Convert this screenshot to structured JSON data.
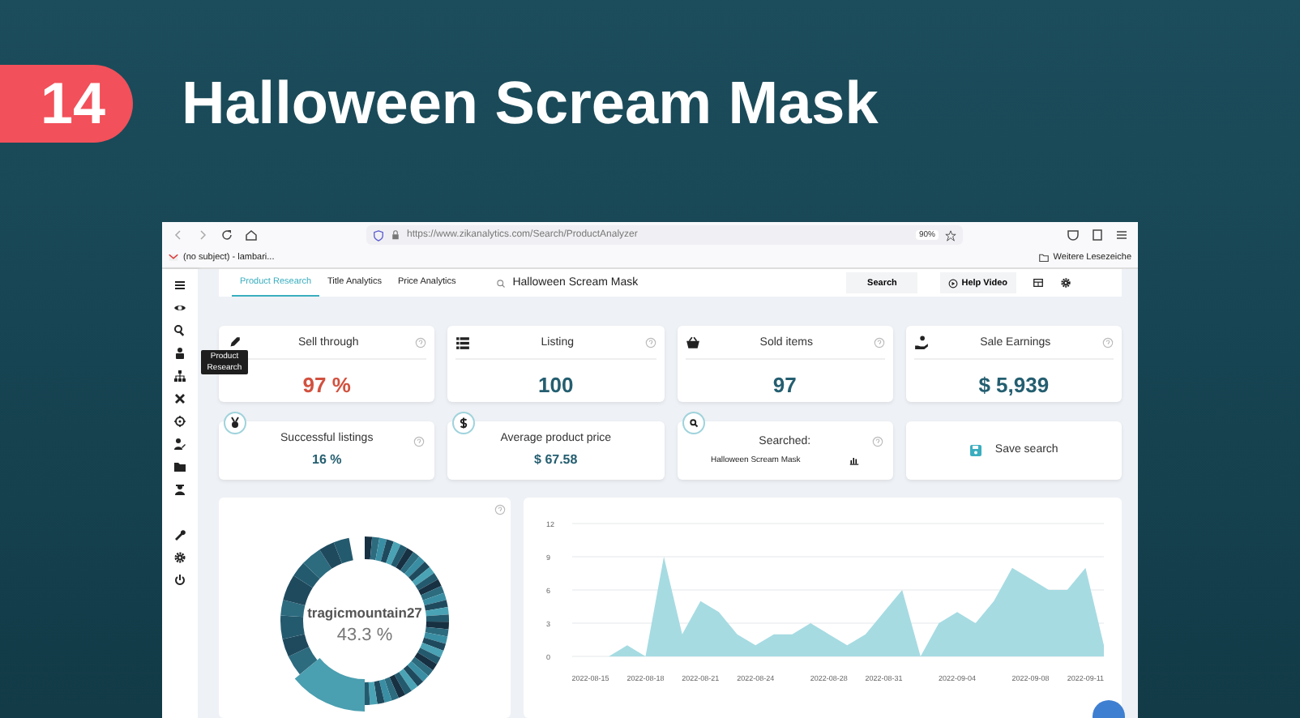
{
  "badge": "14",
  "title": "Halloween Scream Mask",
  "browser": {
    "url": "https://www.zikanalytics.com/Search/ProductAnalyzer",
    "zoom": "90%",
    "bookmarks": [
      {
        "kind": "mail",
        "label": "(no subject) - lambari..."
      },
      {
        "kind": "folder",
        "label": "Weitere Lesezeiche"
      }
    ]
  },
  "nav": {
    "tabs": [
      {
        "label": "Product Research",
        "selected": true
      },
      {
        "label": "Title Analytics",
        "selected": false
      },
      {
        "label": "Price Analytics",
        "selected": false
      }
    ],
    "search": {
      "value": "Halloween Scream Mask"
    },
    "search_button": "Search",
    "help_button": "Help Video"
  },
  "tooltip": "Product Research",
  "stats": [
    {
      "label": "Sell through",
      "value": "97 %",
      "highlight": true
    },
    {
      "label": "Listing",
      "value": "100",
      "highlight": false
    },
    {
      "label": "Sold items",
      "value": "97",
      "highlight": false
    },
    {
      "label": "Sale Earnings",
      "value": "$ 5,939",
      "highlight": false
    }
  ],
  "cards": [
    {
      "kind": "stat",
      "label": "Successful listings",
      "value": "16 %"
    },
    {
      "kind": "stat",
      "label": "Average product price",
      "value": "$ 67.58"
    },
    {
      "kind": "searched",
      "label": "Searched:",
      "value": "Halloween Scream Mask"
    },
    {
      "kind": "action",
      "label": "Save search"
    }
  ],
  "share": {
    "label": "tragicmountain27",
    "value": "43.3 %"
  },
  "sales": {
    "chart_data": {
      "type": "area",
      "categories": [
        null,
        "2022-08-15",
        null,
        null,
        "2022-08-18",
        null,
        null,
        "2022-08-21",
        null,
        null,
        "2022-08-24",
        null,
        null,
        null,
        "2022-08-28",
        null,
        null,
        "2022-08-31",
        null,
        null,
        null,
        "2022-09-04",
        null,
        null,
        null,
        "2022-09-08",
        null,
        null,
        "2022-09-11",
        null
      ],
      "grid": true,
      "series": [
        {
          "color": "#a6dbe2",
          "values": [
            0,
            0,
            0,
            1,
            0,
            9,
            2,
            5,
            4,
            2,
            1,
            2,
            2,
            3,
            2,
            1,
            2,
            4,
            6,
            0,
            3,
            4,
            3,
            5,
            8,
            7,
            6,
            6,
            8,
            1
          ]
        }
      ],
      "ylim": [
        0,
        12
      ],
      "yticks": [
        0,
        3,
        6,
        9,
        12
      ]
    }
  }
}
